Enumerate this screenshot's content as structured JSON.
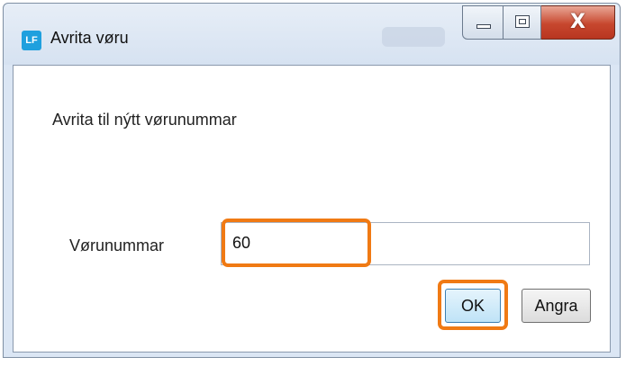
{
  "window": {
    "icon_text": "LF",
    "title": "Avrita vøru"
  },
  "dialog": {
    "heading": "Avrita til nýtt vørunummar",
    "field_label": "Vørunummar",
    "field_value": "60",
    "ok_label": "OK",
    "cancel_label": "Angra"
  },
  "caption": {
    "close_glyph": "X"
  },
  "colors": {
    "highlight": "#f07a14",
    "app_icon": "#1fa0de",
    "close_button": "#c7472e"
  },
  "icons": [
    "app-logo-icon",
    "minimize-icon",
    "maximize-icon",
    "close-icon"
  ]
}
